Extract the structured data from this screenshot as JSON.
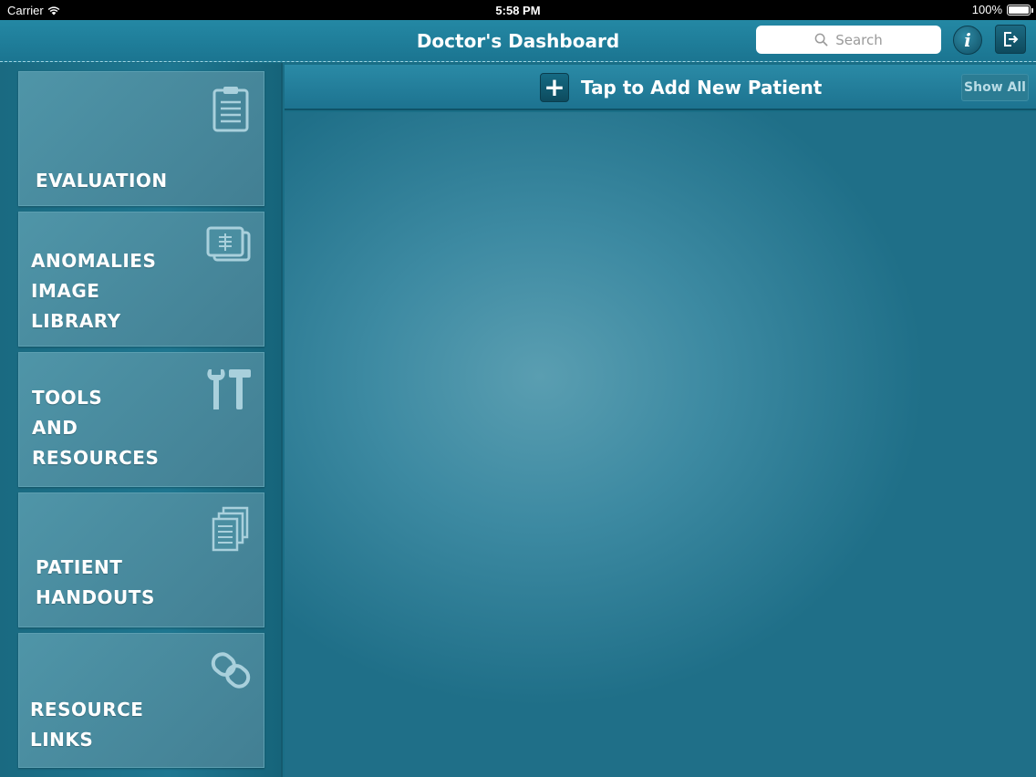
{
  "status_bar": {
    "carrier": "Carrier",
    "time": "5:58 PM",
    "battery": "100%"
  },
  "nav_bar": {
    "title": "Doctor's Dashboard",
    "search_placeholder": "Search",
    "info_label": "i"
  },
  "action_bar": {
    "add_label": "Tap to Add New Patient",
    "show_all_label": "Show All"
  },
  "sidebar": {
    "items": [
      {
        "lines": [
          "EVALUATION"
        ],
        "icon": "clipboard-icon"
      },
      {
        "lines": [
          "ANOMALIES",
          "IMAGE",
          "LIBRARY"
        ],
        "icon": "xray-images-icon"
      },
      {
        "lines": [
          "TOOLS",
          "AND",
          "RESOURCES"
        ],
        "icon": "tools-icon"
      },
      {
        "lines": [
          "PATIENT",
          "HANDOUTS"
        ],
        "icon": "documents-icon"
      },
      {
        "lines": [
          "RESOURCE",
          "LINKS"
        ],
        "icon": "chain-link-icon"
      }
    ]
  },
  "colors": {
    "nav": "#2488a4",
    "tile": "#4f95a8",
    "background": "#1a6e86"
  }
}
